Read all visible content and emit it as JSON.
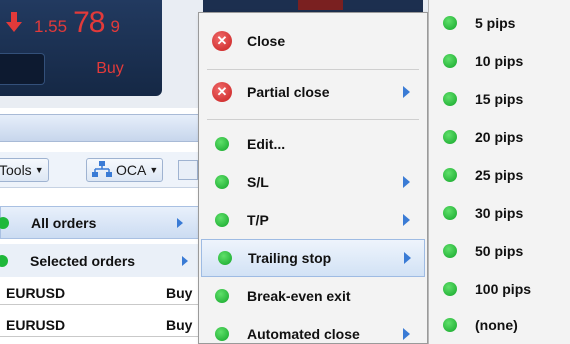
{
  "quote": {
    "price_small": "1.55",
    "price_big": "78",
    "price_tail": "9",
    "buy_label": "Buy"
  },
  "toolbar": {
    "tools_label": "Tools",
    "oca_label": "OCA"
  },
  "orders_menu": {
    "all_orders": "All orders",
    "selected_orders": "Selected orders"
  },
  "grid_rows": [
    {
      "symbol": "EURUSD",
      "side": "Buy"
    },
    {
      "symbol": "EURUSD",
      "side": "Buy"
    }
  ],
  "context_menu": {
    "items": [
      {
        "label": "Close",
        "icon": "close-icon",
        "submenu": false
      },
      {
        "label": "Partial close",
        "icon": "close-icon",
        "submenu": true
      },
      {
        "label": "Edit...",
        "icon": "green-dot-icon",
        "submenu": false
      },
      {
        "label": "S/L",
        "icon": "green-dot-icon",
        "submenu": true
      },
      {
        "label": "T/P",
        "icon": "green-dot-icon",
        "submenu": true
      },
      {
        "label": "Trailing stop",
        "icon": "green-dot-icon",
        "submenu": true,
        "highlighted": true
      },
      {
        "label": "Break-even exit",
        "icon": "green-dot-icon",
        "submenu": false
      },
      {
        "label": "Automated close",
        "icon": "green-dot-icon",
        "submenu": true
      }
    ]
  },
  "trailing_stop_menu": {
    "items": [
      "5 pips",
      "10 pips",
      "15 pips",
      "20 pips",
      "25 pips",
      "30 pips",
      "50 pips",
      "100 pips",
      "(none)"
    ]
  },
  "colors": {
    "accent_blue": "#3a7bd5",
    "sell_red": "#e23a3a",
    "green": "#1fb83a",
    "menu_bg": "#f3f3f3"
  }
}
